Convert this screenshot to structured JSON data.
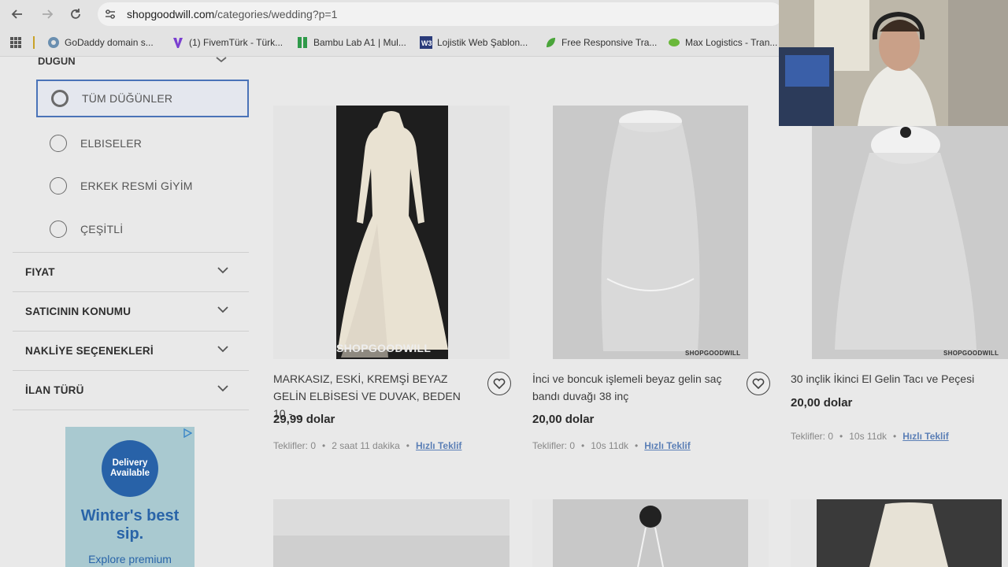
{
  "browser": {
    "url_host": "shopgoodwill.com",
    "url_path": "/categories/wedding?p=1",
    "bookmarks": [
      {
        "label": "GoDaddy domain s...",
        "icon": "godaddy-icon",
        "color": "#6a8fb0"
      },
      {
        "label": "(1) FivemTürk - Türk...",
        "icon": "fivem-icon",
        "color": "#7a3fd0"
      },
      {
        "label": "Bambu Lab A1 | Mul...",
        "icon": "bambu-icon",
        "color": "#2f9a4a"
      },
      {
        "label": "Lojistik Web Şablon...",
        "icon": "w3-icon",
        "color": "#2a3b7a"
      },
      {
        "label": "Free Responsive Tra...",
        "icon": "leaf-icon",
        "color": "#4aa53a"
      },
      {
        "label": "Max Logistics - Tran...",
        "icon": "leaf-green-icon",
        "color": "#6ab83a"
      }
    ]
  },
  "sidebar": {
    "section_title": "DÜĞÜN",
    "options": [
      {
        "label": "TÜM DÜĞÜNLER",
        "selected": true
      },
      {
        "label": "ELBISELER",
        "selected": false
      },
      {
        "label": "ERKEK RESMİ GİYİM",
        "selected": false
      },
      {
        "label": "ÇEŞİTLİ",
        "selected": false
      }
    ],
    "filters": [
      "FIYAT",
      "SATICININ KONUMU",
      "NAKLİYE SEÇENEKLERİ",
      "İLAN TÜRÜ"
    ],
    "ad": {
      "badge": "Delivery Available",
      "title": "Winter's best sip.",
      "cta": "Explore premium"
    }
  },
  "products": [
    {
      "title": "MARKASIZ, ESKİ, KREMŞİ BEYAZ GELİN ELBİSESİ VE DUVAK, BEDEN 10 -...",
      "price": "29,99 dolar",
      "bids": "Teklifler: 0",
      "time": "2 saat 11 dakika",
      "quick_bid": "Hızlı Teklif",
      "watermark": "SHOPGOODWILL"
    },
    {
      "title": "İnci ve boncuk işlemeli beyaz gelin saç bandı duvağı 38 inç",
      "price": "20,00 dolar",
      "bids": "Teklifler: 0",
      "time": "10s 11dk",
      "quick_bid": "Hızlı Teklif",
      "watermark": "SHOPGOODWILL"
    },
    {
      "title": "30 inçlik İkinci El Gelin Tacı ve Peçesi",
      "price": "20,00 dolar",
      "bids": "Teklifler: 0",
      "time": "10s 11dk",
      "quick_bid": "Hızlı Teklif",
      "watermark": "SHOPGOODWILL"
    }
  ],
  "colors": {
    "accent": "#4a73b8",
    "quick_bid": "#5b7fb6",
    "ad_blue": "#2862a8"
  }
}
